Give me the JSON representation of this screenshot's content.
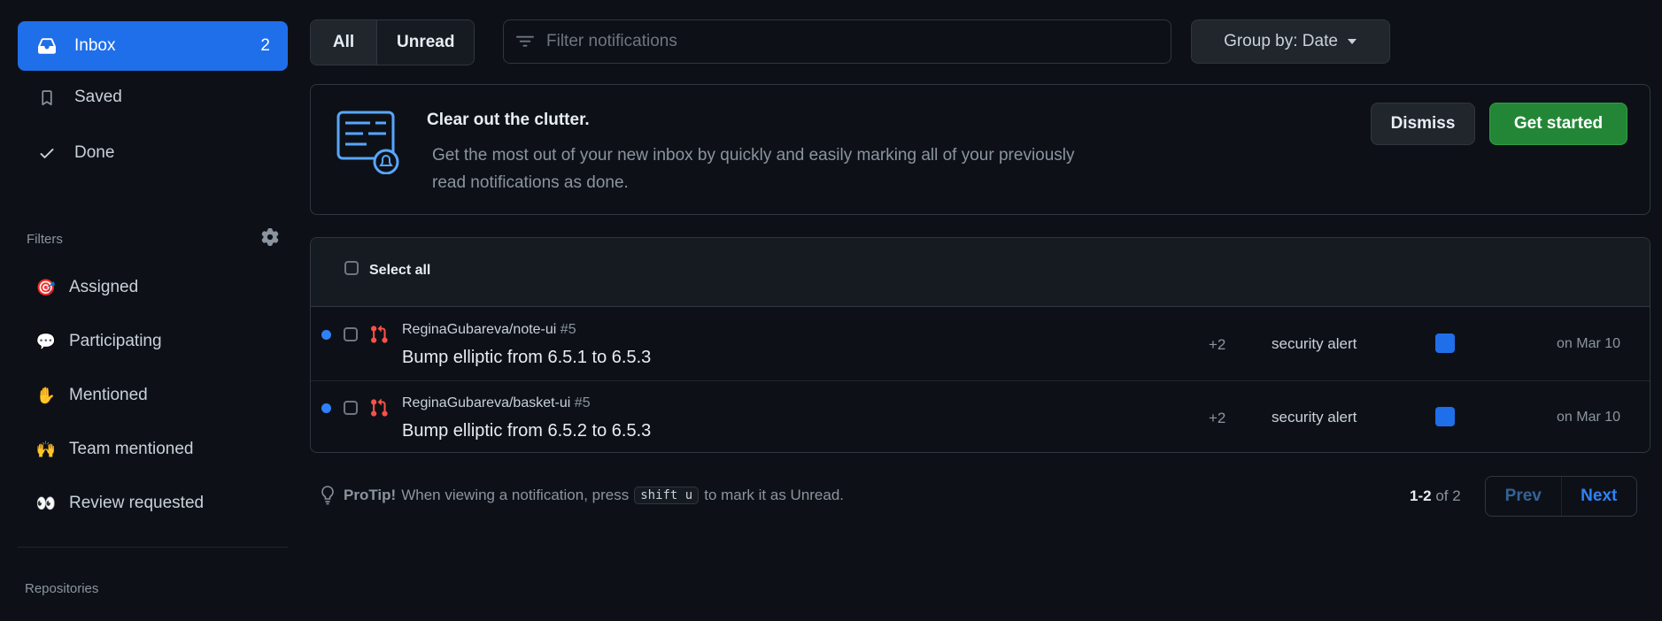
{
  "sidebar": {
    "inbox": {
      "label": "Inbox",
      "count": "2"
    },
    "saved": {
      "label": "Saved"
    },
    "done": {
      "label": "Done"
    },
    "filters_heading": "Filters",
    "filters": [
      {
        "label": "Assigned",
        "icon": "target-icon"
      },
      {
        "label": "Participating",
        "icon": "speech-icon"
      },
      {
        "label": "Mentioned",
        "icon": "raised-hand-icon"
      },
      {
        "label": "Team mentioned",
        "icon": "raised-hands-icon"
      },
      {
        "label": "Review requested",
        "icon": "eyes-icon"
      }
    ],
    "repositories_heading": "Repositories"
  },
  "toolbar": {
    "all_label": "All",
    "unread_label": "Unread",
    "filter_placeholder": "Filter notifications",
    "group_by_label": "Group by: Date"
  },
  "banner": {
    "title": "Clear out the clutter.",
    "description_line1": "Get the most out of your new inbox by quickly and easily marking all of your previously",
    "description_line2": "read notifications as done.",
    "dismiss_label": "Dismiss",
    "get_started_label": "Get started"
  },
  "list": {
    "select_all_label": "Select all",
    "notifications": [
      {
        "repo": "ReginaGubareva/note-ui",
        "number": "#5",
        "title": "Bump elliptic from 6.5.1 to 6.5.3",
        "participants": "+2",
        "reason": "security alert",
        "date": "on Mar 10"
      },
      {
        "repo": "ReginaGubareva/basket-ui",
        "number": "#5",
        "title": "Bump elliptic from 6.5.2 to 6.5.3",
        "participants": "+2",
        "reason": "security alert",
        "date": "on Mar 10"
      }
    ]
  },
  "footer": {
    "protip_label": "ProTip!",
    "protip_text_before": "When viewing a notification, press",
    "protip_key": "shift u",
    "protip_text_after": "to mark it as Unread.",
    "pager_range": "1-2",
    "pager_of": "of 2",
    "prev_label": "Prev",
    "next_label": "Next"
  },
  "colors": {
    "background": "#0d1117",
    "accent": "#1f6feb",
    "primary_button": "#238636",
    "link": "#2f81f7"
  }
}
